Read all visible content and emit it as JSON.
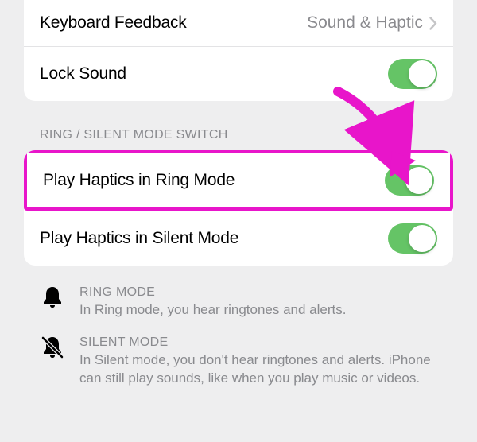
{
  "group1": {
    "keyboard_feedback": {
      "label": "Keyboard Feedback",
      "value": "Sound & Haptic"
    },
    "lock_sound": {
      "label": "Lock Sound",
      "enabled": true
    }
  },
  "section_header": "RING / SILENT MODE SWITCH",
  "group2": {
    "ring_haptics": {
      "label": "Play Haptics in Ring Mode",
      "enabled": true
    },
    "silent_haptics": {
      "label": "Play Haptics in Silent Mode",
      "enabled": true
    }
  },
  "info": {
    "ring": {
      "title": "RING MODE",
      "desc": "In Ring mode, you hear ringtones and alerts."
    },
    "silent": {
      "title": "SILENT MODE",
      "desc": "In Silent mode, you don't hear ringtones and alerts. iPhone can still play sounds, like when you play music or videos."
    }
  },
  "annotation": {
    "highlight_target": "ring_haptics",
    "arrow_color": "#e815ca"
  }
}
